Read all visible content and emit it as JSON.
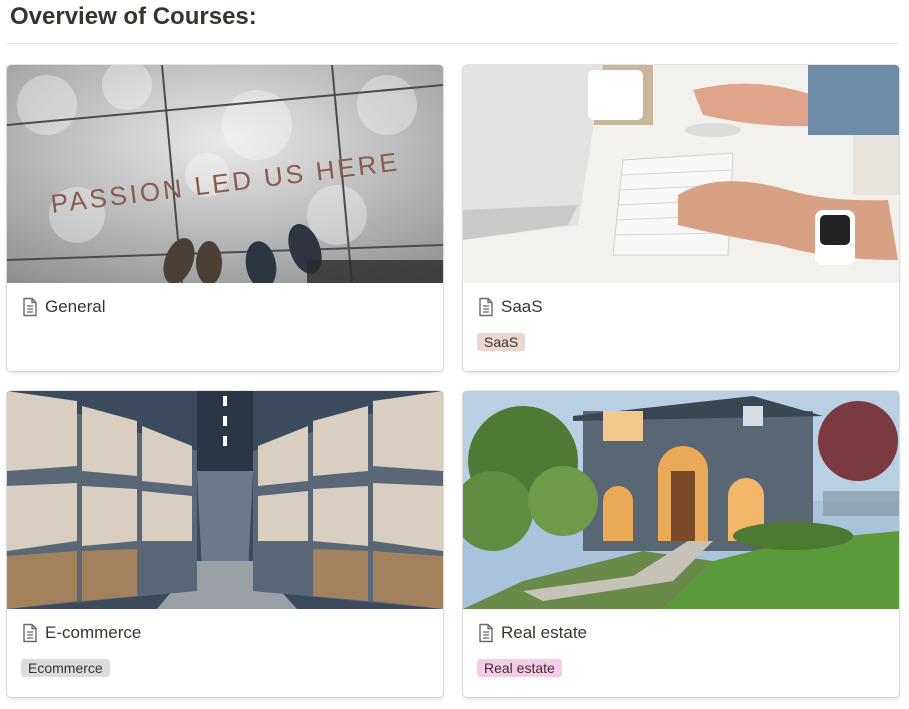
{
  "page": {
    "title": "Overview of Courses:"
  },
  "cards": [
    {
      "title": "General",
      "tag": "",
      "cover": "sidewalk-passion-photo",
      "cover_text": "PASSION LED US HERE"
    },
    {
      "title": "SaaS",
      "tag": "SaaS",
      "tag_color": "#e9d7d0",
      "cover": "desk-keyboard-photo"
    },
    {
      "title": "E-commerce",
      "tag": "Ecommerce",
      "tag_color": "#dcdcdc",
      "cover": "warehouse-aisle-photo"
    },
    {
      "title": "Real estate",
      "tag": "Real estate",
      "tag_color": "#f5cbe5",
      "cover": "house-exterior-photo"
    }
  ],
  "icons": {
    "card_icon": "document-icon"
  }
}
